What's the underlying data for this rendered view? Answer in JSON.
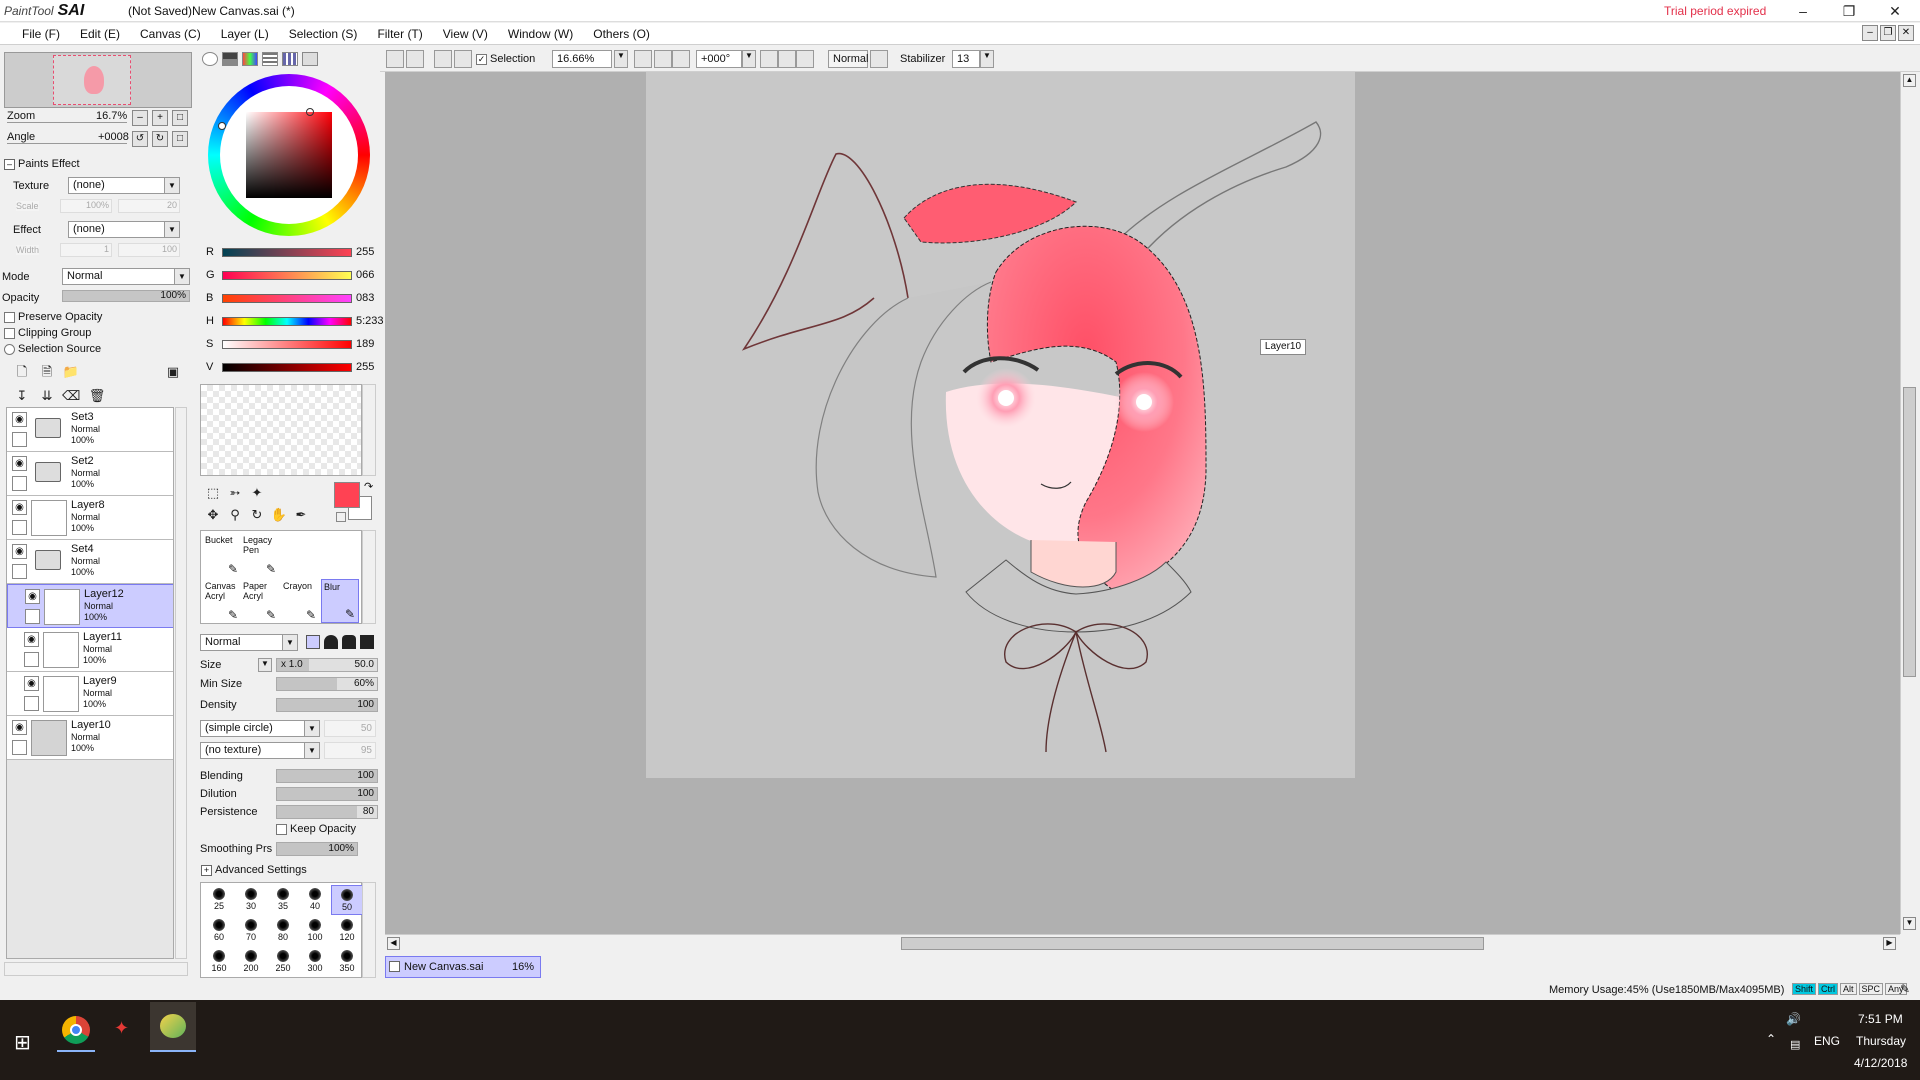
{
  "app": {
    "logo_small": "PaintTool",
    "logo_big": "SAI",
    "title": "(Not Saved)New Canvas.sai (*)",
    "trial": "Trial period expired"
  },
  "menu": [
    "File (F)",
    "Edit (E)",
    "Canvas (C)",
    "Layer (L)",
    "Selection (S)",
    "Filter (T)",
    "View (V)",
    "Window (W)",
    "Others (O)"
  ],
  "toolbar": {
    "selection_label": "Selection",
    "zoom_value": "16.66%",
    "angle_value": "+000°",
    "blend_mode": "Normal",
    "stabilizer_label": "Stabilizer",
    "stabilizer_value": "13"
  },
  "navigator": {
    "zoom_label": "Zoom",
    "zoom_value": "16.7%",
    "angle_label": "Angle",
    "angle_value": "+0008"
  },
  "paints_effect": {
    "header": "Paints Effect",
    "texture_label": "Texture",
    "texture_value": "(none)",
    "scale_label": "Scale",
    "scale_value": "100%",
    "scale_num": "20",
    "effect_label": "Effect",
    "effect_value": "(none)",
    "width_label": "Width",
    "width_value": "1",
    "width_num": "100"
  },
  "layer_props": {
    "mode_label": "Mode",
    "mode_value": "Normal",
    "opacity_label": "Opacity",
    "opacity_value": "100%",
    "preserve_opacity": "Preserve Opacity",
    "clipping_group": "Clipping Group",
    "selection_source": "Selection Source"
  },
  "layers": [
    {
      "name": "Set3",
      "mode": "Normal",
      "opacity": "100%",
      "folder": true
    },
    {
      "name": "Set2",
      "mode": "Normal",
      "opacity": "100%",
      "folder": true
    },
    {
      "name": "Layer8",
      "mode": "Normal",
      "opacity": "100%"
    },
    {
      "name": "Set4",
      "mode": "Normal",
      "opacity": "100%",
      "folder": true
    },
    {
      "name": "Layer12",
      "mode": "Normal",
      "opacity": "100%",
      "selected": true
    },
    {
      "name": "Layer11",
      "mode": "Normal",
      "opacity": "100%"
    },
    {
      "name": "Layer9",
      "mode": "Normal",
      "opacity": "100%"
    },
    {
      "name": "Layer10",
      "mode": "Normal",
      "opacity": "100%"
    }
  ],
  "color": {
    "r_label": "R",
    "r_value": "255",
    "g_label": "G",
    "g_value": "066",
    "b_label": "B",
    "b_value": "083",
    "h_label": "H",
    "h_value": "5:233",
    "s_label": "S",
    "s_value": "189",
    "v_label": "V",
    "v_value": "255",
    "primary": "#ff4253",
    "secondary": "#ffffff"
  },
  "tools": [
    {
      "line1": "Bucket",
      "line2": ""
    },
    {
      "line1": "Legacy",
      "line2": "Pen"
    },
    {
      "line1": "Canvas",
      "line2": "Acryl"
    },
    {
      "line1": "Paper",
      "line2": "Acryl"
    },
    {
      "line1": "Crayon",
      "line2": ""
    },
    {
      "line1": "Blur",
      "line2": "",
      "selected": true
    }
  ],
  "brush": {
    "mode": "Normal",
    "size_label": "Size",
    "size_mult": "x 1.0",
    "size_value": "50.0",
    "min_size_label": "Min Size",
    "min_size_value": "60%",
    "density_label": "Density",
    "density_value": "100",
    "shape": "(simple circle)",
    "shape_value": "50",
    "texture": "(no texture)",
    "texture_value": "95",
    "blending_label": "Blending",
    "blending_value": "100",
    "dilution_label": "Dilution",
    "dilution_value": "100",
    "persistence_label": "Persistence",
    "persistence_value": "80",
    "keep_opacity": "Keep Opacity",
    "smoothing_label": "Smoothing Prs",
    "smoothing_value": "100%",
    "advanced": "Advanced Settings"
  },
  "brush_sizes": [
    "25",
    "30",
    "35",
    "40",
    "50",
    "60",
    "70",
    "80",
    "100",
    "120",
    "160",
    "200",
    "250",
    "300",
    "350"
  ],
  "canvas": {
    "layer_tooltip": "Layer10",
    "doc_tab": "New Canvas.sai",
    "doc_zoom": "16%"
  },
  "status": {
    "memory": "Memory Usage:45% (Use1850MB/Max4095MB)",
    "keys": [
      "Shift",
      "Ctrl",
      "Alt",
      "SPC",
      "Any"
    ]
  },
  "taskbar": {
    "time": "7:51 PM",
    "day": "Thursday",
    "date": "4/12/2018",
    "lang": "ENG"
  }
}
